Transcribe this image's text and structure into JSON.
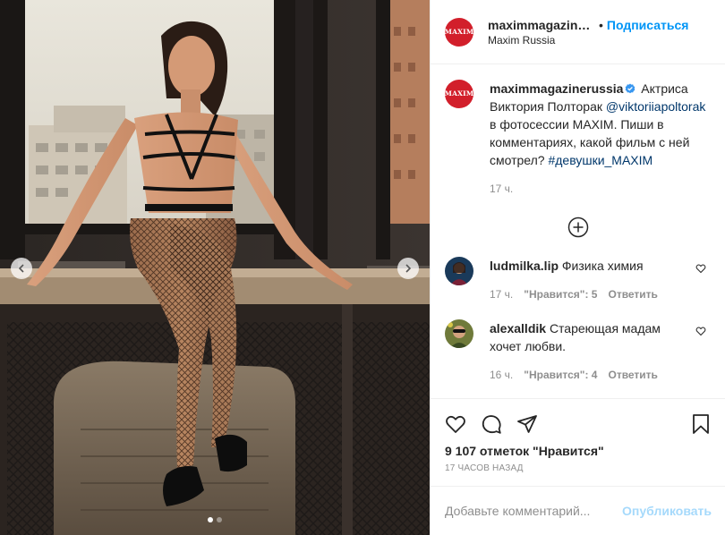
{
  "header": {
    "username": "maximmagazinerussia",
    "separator": "•",
    "follow_label": "Подписаться",
    "location": "Maxim Russia",
    "logo_text": "MAXIM"
  },
  "caption": {
    "username": "maximmagazinerussia",
    "text_before": " Актриса Виктория Полторак ",
    "mention": "@viktoriiapoltorak",
    "text_after": " в фотосессии MAXIM. Пиши в комментариях, какой фильм с ней смотрел? ",
    "hashtag": "#девушки_MAXIM",
    "time": "17 ч."
  },
  "comments": [
    {
      "username": "ludmilka.lip",
      "text": "Физика химия",
      "time": "17 ч.",
      "likes": "\"Нравится\": 5",
      "reply": "Ответить"
    },
    {
      "username": "alexalldik",
      "text": "Стареющая мадам хочет любви.",
      "time": "16 ч.",
      "likes": "\"Нравится\": 4",
      "reply": "Ответить"
    }
  ],
  "stats": {
    "likes": "9 107 отметок \"Нравится\"",
    "posted": "17 часов назад"
  },
  "add_comment": {
    "placeholder": "Добавьте комментарий...",
    "post_label": "Опубликовать"
  },
  "carousel": {
    "slide_count": 2,
    "active_index": 0
  },
  "colors": {
    "accent": "#0095f6",
    "brand_red": "#d21f2b",
    "text": "#262626",
    "muted": "#8e8e8e"
  },
  "icons": [
    "chevron-left-icon",
    "chevron-right-icon",
    "verified-icon",
    "plus-circle-icon",
    "heart-icon",
    "comment-icon",
    "share-icon",
    "bookmark-icon"
  ]
}
